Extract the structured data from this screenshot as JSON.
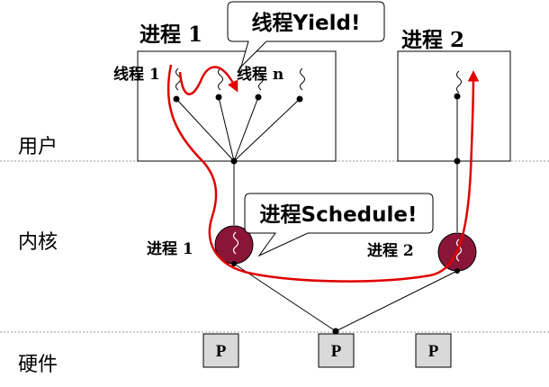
{
  "layers": {
    "user": "用户",
    "kernel": "内核",
    "hardware": "硬件"
  },
  "process1": {
    "title": "进程 1",
    "thread_first": "线程 1",
    "thread_last": "线程 n"
  },
  "process2": {
    "title": "进程 2"
  },
  "kernel_entities": {
    "p1": "进程 1",
    "p2": "进程 2"
  },
  "callouts": {
    "yield": "线程Yield!",
    "schedule": "进程Schedule!"
  },
  "cpus": [
    "P",
    "P",
    "P"
  ],
  "colors": {
    "arrow": "#e00000",
    "kernel_entity": "#8b1538",
    "cpu_fill": "#d9d9d9",
    "separator": "#999999"
  }
}
